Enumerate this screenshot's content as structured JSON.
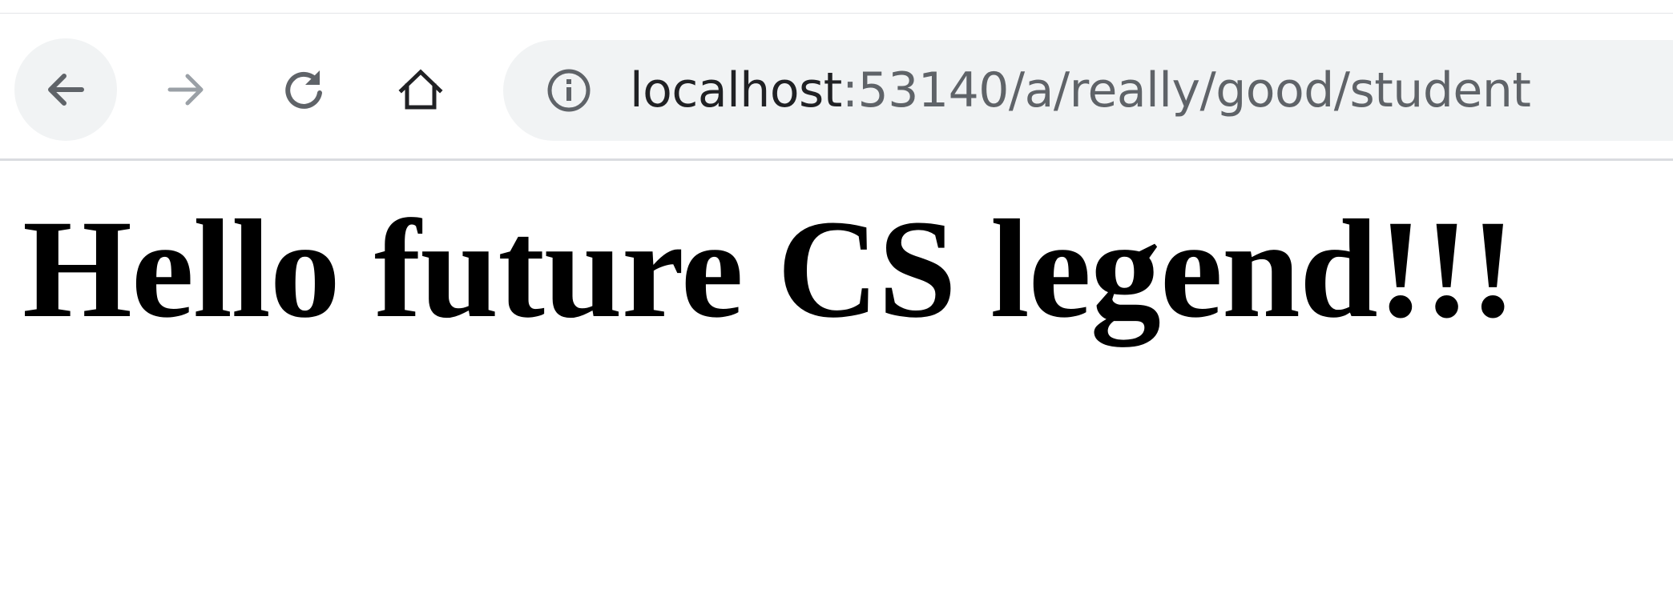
{
  "browser": {
    "toolbar": {
      "back_icon": "arrow-left-icon",
      "forward_icon": "arrow-right-icon",
      "reload_icon": "reload-icon",
      "home_icon": "home-icon"
    },
    "omnibox": {
      "info_icon": "info-circle-icon",
      "url_host": "localhost",
      "url_rest": ":53140/a/really/good/student"
    }
  },
  "page": {
    "heading": "Hello future CS legend!!!"
  },
  "colors": {
    "omnibox_bg": "#f1f3f4",
    "icon_active": "#5f6368",
    "icon_disabled": "#9aa0a6",
    "url_host": "#202124",
    "url_rest": "#5f6368",
    "heading": "#000000"
  }
}
